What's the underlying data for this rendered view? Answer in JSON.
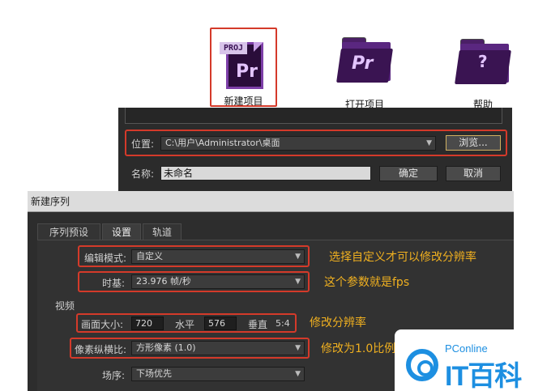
{
  "launcher": {
    "new_project": {
      "label": "新建项目",
      "tag": "PROJ",
      "glyph": "Pr"
    },
    "open_project": {
      "label": "打开项目",
      "glyph": "Pr"
    },
    "help": {
      "label": "帮助",
      "glyph": "?"
    }
  },
  "project_dialog": {
    "location_label": "位置:",
    "location_value": "C:\\用户\\Administrator\\桌面",
    "browse_button": "浏览...",
    "name_label": "名称:",
    "name_value": "未命名",
    "ok_button": "确定",
    "cancel_button": "取消"
  },
  "sequence_dialog": {
    "title": "新建序列",
    "tabs": [
      "序列预设",
      "设置",
      "轨道"
    ],
    "active_tab": "设置",
    "editing_mode": {
      "label": "编辑模式:",
      "value": "自定义",
      "note": "选择自定义才可以修改分辨率"
    },
    "timebase": {
      "label": "时基:",
      "value": "23.976 帧/秒",
      "note": "这个参数就是fps"
    },
    "video_group": "视频",
    "frame_size": {
      "label": "画面大小:",
      "width": "720",
      "width_label": "水平",
      "height": "576",
      "height_label": "垂直",
      "aspect": "5:4",
      "note": "修改分辨率"
    },
    "pixel_aspect": {
      "label": "像素纵横比:",
      "value": "方形像素 (1.0)",
      "note": "修改为1.0比例"
    },
    "field_order": {
      "label": "场序:",
      "value": "下场优先"
    }
  },
  "watermark": {
    "brand": "PConline",
    "text": "IT百科"
  },
  "colors": {
    "highlight_red": "#d43a2a",
    "note_yellow": "#f0b020",
    "brand_blue": "#1d8fe1"
  }
}
